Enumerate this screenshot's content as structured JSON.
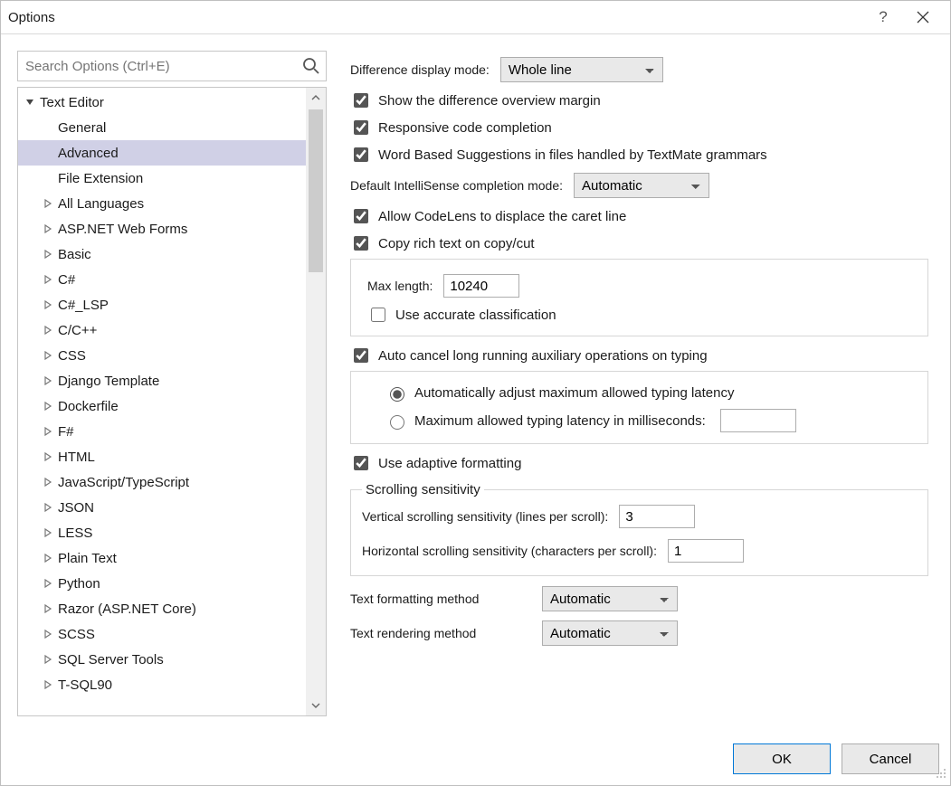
{
  "window": {
    "title": "Options"
  },
  "search": {
    "placeholder": "Search Options (Ctrl+E)"
  },
  "tree": {
    "root": "Text Editor",
    "children": [
      "General",
      "Advanced",
      "File Extension"
    ],
    "selected": "Advanced",
    "collapsed": [
      "All Languages",
      "ASP.NET Web Forms",
      "Basic",
      "C#",
      "C#_LSP",
      "C/C++",
      "CSS",
      "Django Template",
      "Dockerfile",
      "F#",
      "HTML",
      "JavaScript/TypeScript",
      "JSON",
      "LESS",
      "Plain Text",
      "Python",
      "Razor (ASP.NET Core)",
      "SCSS",
      "SQL Server Tools",
      "T-SQL90"
    ]
  },
  "panel": {
    "diff_mode_label": "Difference display mode:",
    "diff_mode_value": "Whole line",
    "show_diff_overview": "Show the difference overview margin",
    "responsive_completion": "Responsive code completion",
    "word_based_suggestions": "Word Based Suggestions in files handled by TextMate grammars",
    "intellisense_mode_label": "Default IntelliSense completion mode:",
    "intellisense_mode_value": "Automatic",
    "allow_codelens": "Allow CodeLens to displace the caret line",
    "copy_rich_text": "Copy rich text on copy/cut",
    "max_length_label": "Max length:",
    "max_length_value": "10240",
    "use_accurate_class": "Use accurate classification",
    "auto_cancel": "Auto cancel long running auxiliary operations on typing",
    "radio_auto_adjust": "Automatically adjust maximum allowed typing latency",
    "radio_max_latency": "Maximum allowed typing latency in milliseconds:",
    "max_latency_value": "",
    "use_adaptive_formatting": "Use adaptive formatting",
    "scroll_legend": "Scrolling sensitivity",
    "vscroll_label": "Vertical scrolling sensitivity (lines per scroll):",
    "vscroll_value": "3",
    "hscroll_label": "Horizontal scrolling sensitivity (characters per scroll):",
    "hscroll_value": "1",
    "text_formatting_label": "Text formatting method",
    "text_formatting_value": "Automatic",
    "text_rendering_label": "Text rendering method",
    "text_rendering_value": "Automatic"
  },
  "buttons": {
    "ok": "OK",
    "cancel": "Cancel"
  }
}
